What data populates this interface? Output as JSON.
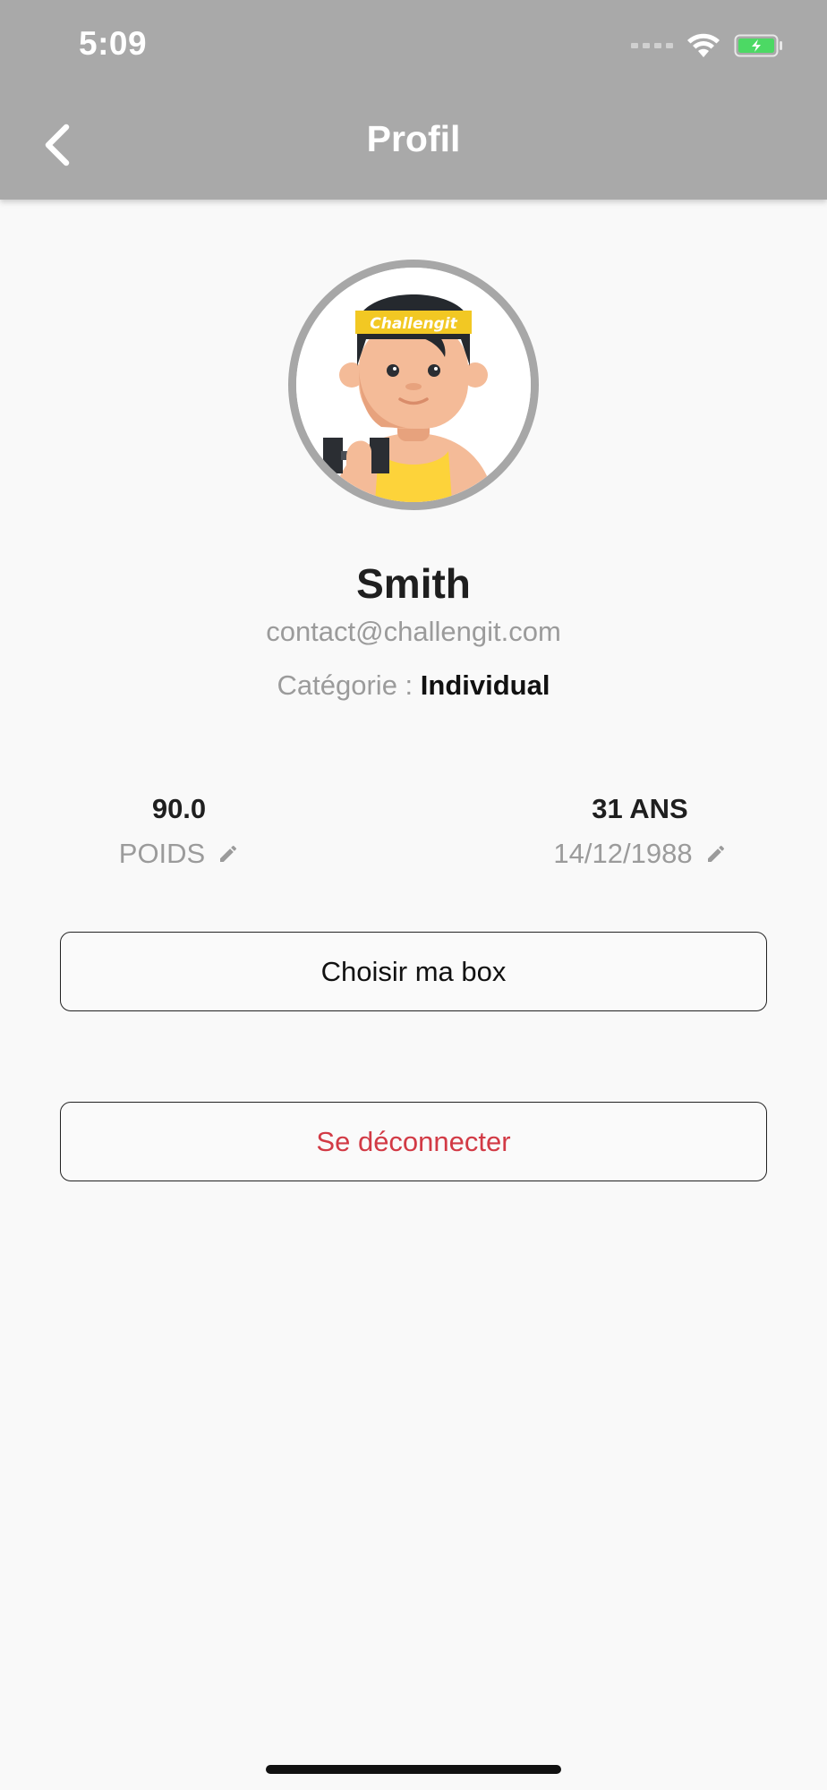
{
  "status_bar": {
    "time": "5:09",
    "icons": [
      "signal-icon",
      "wifi-icon",
      "battery-charging-icon"
    ]
  },
  "header": {
    "title": "Profil",
    "back_icon": "chevron-left-icon",
    "background": "#a9a9a9"
  },
  "profile": {
    "avatar_text": "Challengit",
    "name": "Smith",
    "email": "contact@challengit.com",
    "category_label": "Catégorie : ",
    "category_value": "Individual"
  },
  "stats": {
    "weight_value": "90.0",
    "weight_label": "POIDS",
    "age_value": "31 ANS",
    "birthdate": "14/12/1988"
  },
  "buttons": {
    "choose_box": "Choisir ma box",
    "logout": "Se déconnecter"
  },
  "colors": {
    "logout_text": "#d23a45",
    "avatar_ring": "#a7a7a7",
    "headband": "#f2c823"
  }
}
